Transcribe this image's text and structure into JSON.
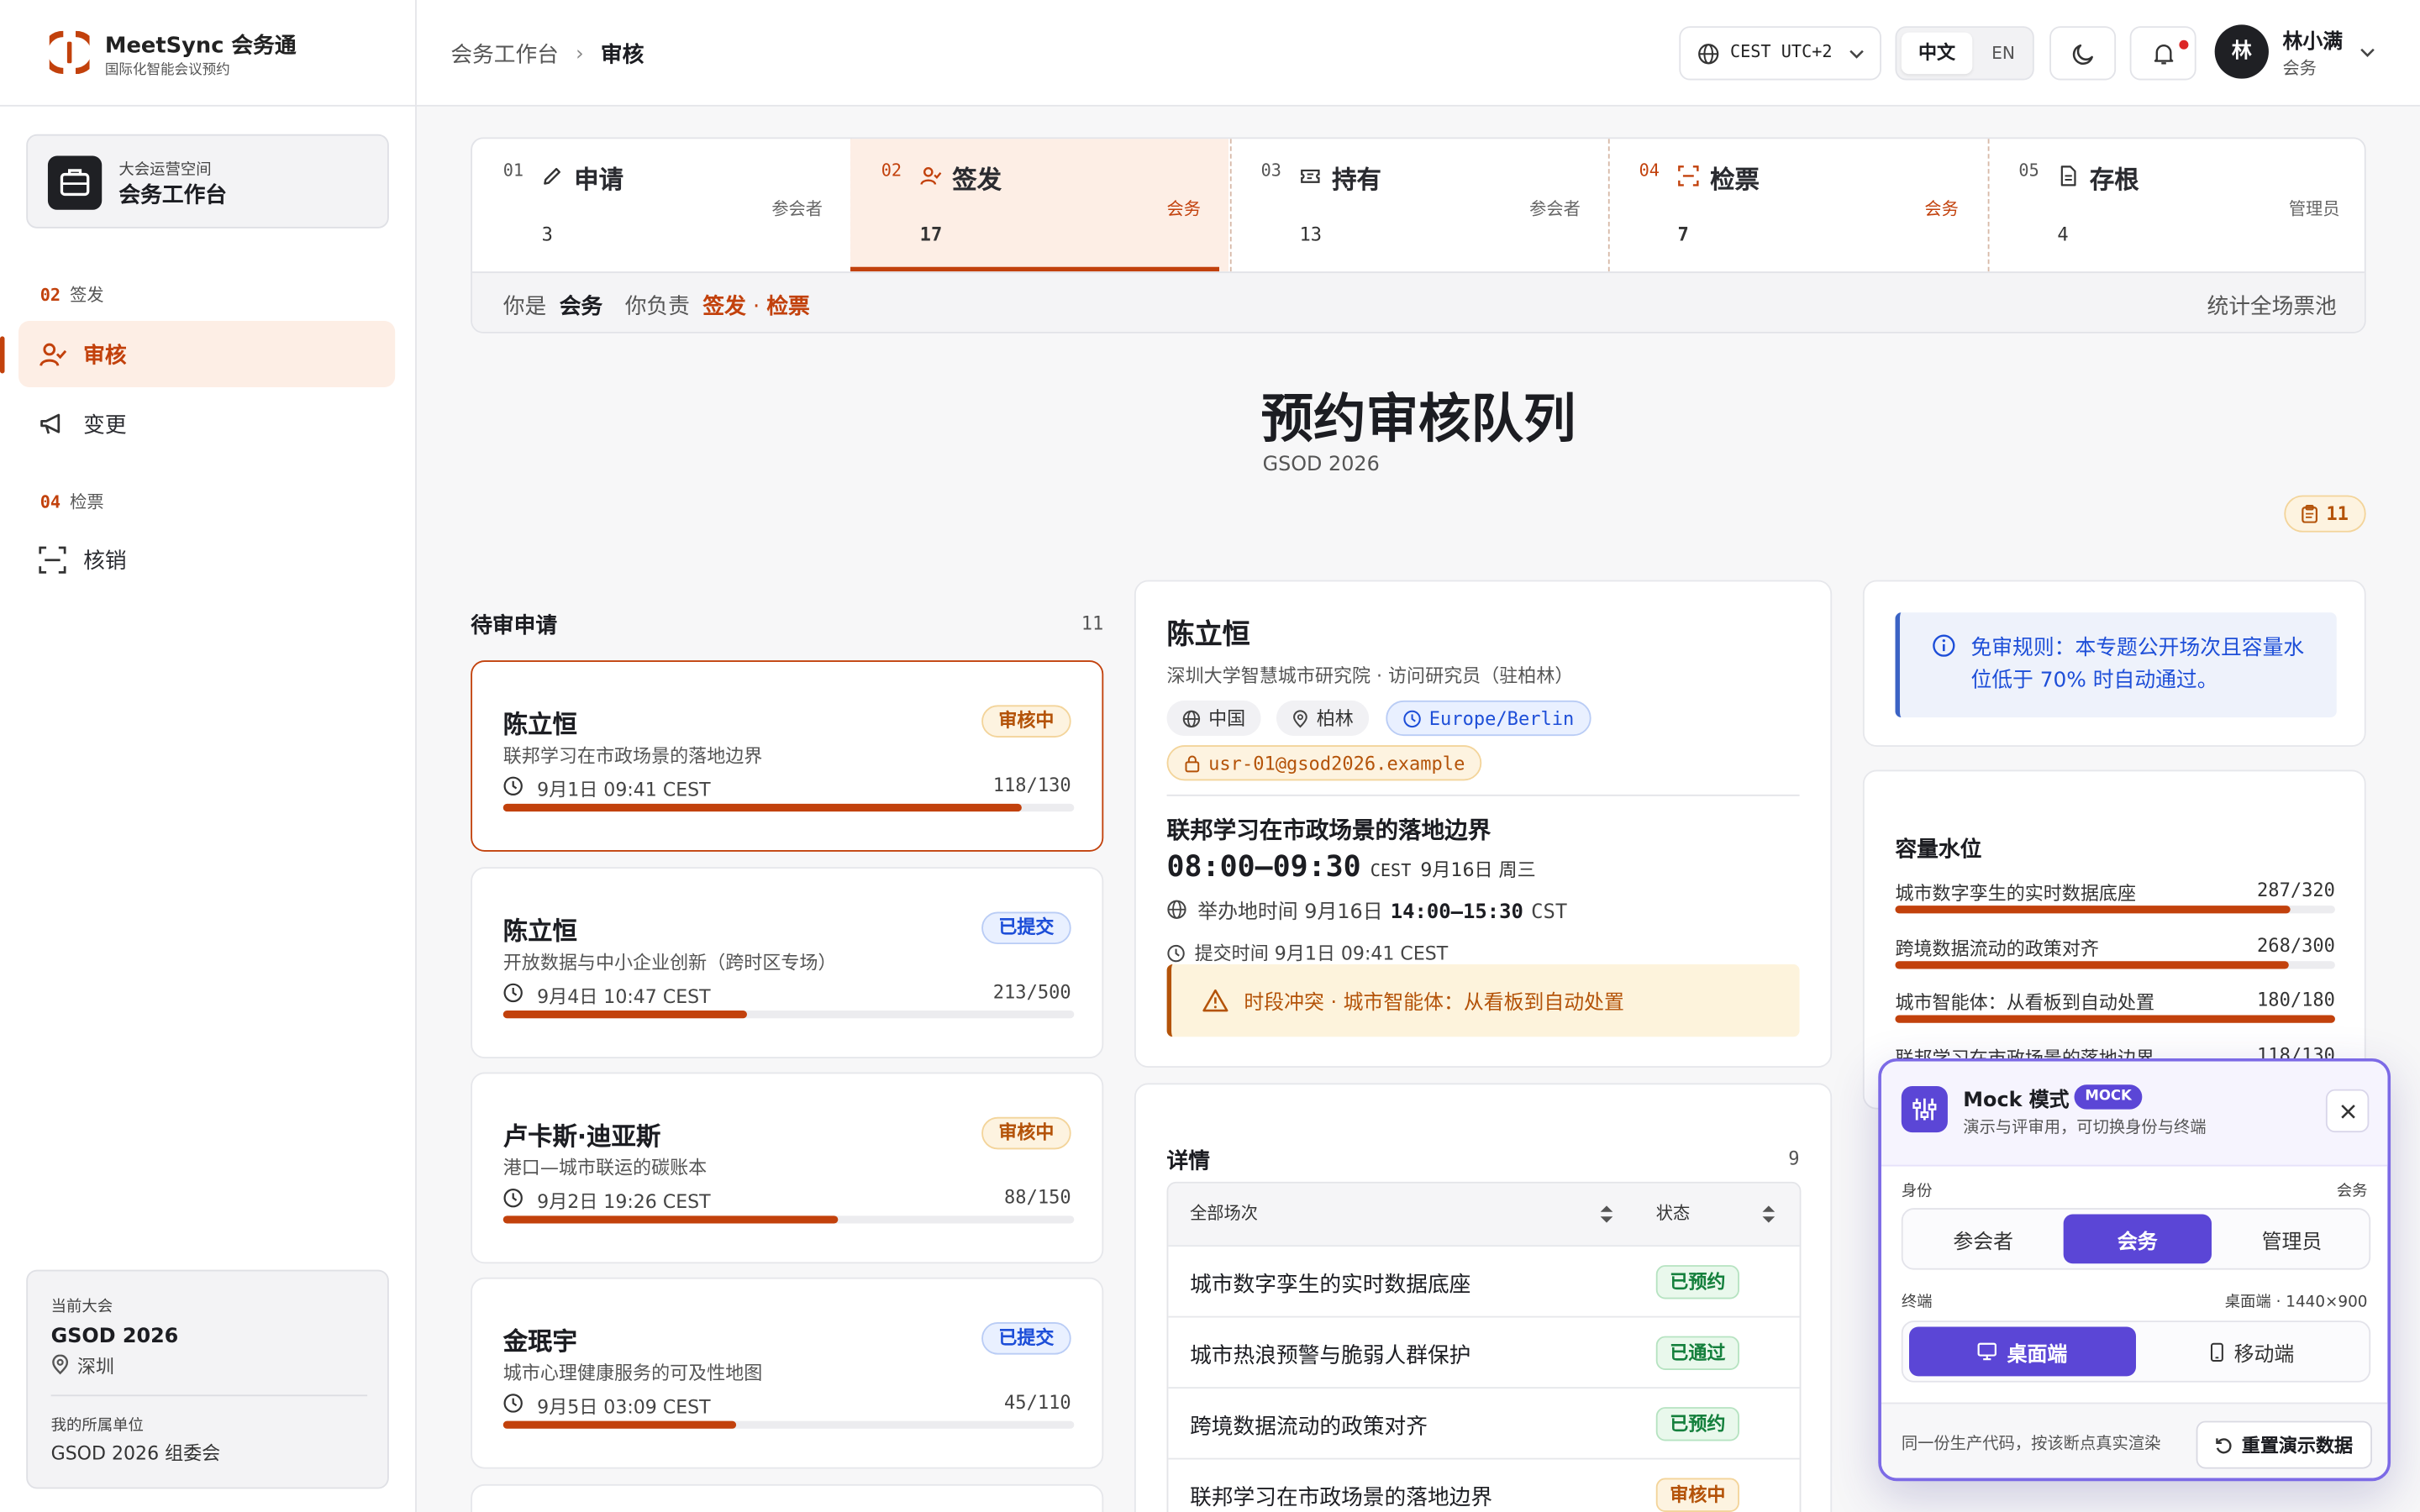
{
  "brand": {
    "name": "MeetSync 会务通",
    "tagline": "国际化智能会议预约"
  },
  "workspace": {
    "label": "大会运营空间",
    "name": "会务工作台"
  },
  "sidebar": {
    "sections": [
      {
        "num": "02",
        "label": "签发",
        "items": [
          {
            "label": "审核",
            "icon": "user-check-icon",
            "active": true
          },
          {
            "label": "变更",
            "icon": "megaphone-icon",
            "active": false
          }
        ]
      },
      {
        "num": "04",
        "label": "检票",
        "items": [
          {
            "label": "核销",
            "icon": "scan-icon",
            "active": false
          }
        ]
      }
    ],
    "conference": {
      "label": "当前大会",
      "name": "GSOD 2026",
      "city": "深圳",
      "unit_label": "我的所属单位",
      "unit": "GSOD 2026 组委会"
    }
  },
  "breadcrumb": {
    "parent": "会务工作台",
    "current": "审核"
  },
  "header": {
    "timezone": "CEST UTC+2",
    "lang_zh": "中文",
    "lang_en": "EN",
    "user_name": "林小满",
    "user_role": "会务",
    "avatar": "林"
  },
  "stepper": {
    "steps": [
      {
        "num": "01",
        "name": "申请",
        "role": "参会者",
        "count": "3",
        "icon": "pen-icon"
      },
      {
        "num": "02",
        "name": "签发",
        "role": "会务",
        "count": "17",
        "icon": "user-check-icon"
      },
      {
        "num": "03",
        "name": "持有",
        "role": "参会者",
        "count": "13",
        "icon": "ticket-icon"
      },
      {
        "num": "04",
        "name": "检票",
        "role": "会务",
        "count": "7",
        "icon": "scan-icon"
      },
      {
        "num": "05",
        "name": "存根",
        "role": "管理员",
        "count": "4",
        "icon": "file-icon"
      }
    ],
    "footer": {
      "you_are": "你是",
      "role": "会务",
      "responsible": "你负责",
      "duty1": "签发",
      "sep": "·",
      "duty2": "检票",
      "stats_link": "统计全场票池"
    }
  },
  "page": {
    "title": "预约审核队列",
    "subtitle": "GSOD 2026",
    "pending_count": "11"
  },
  "queue": {
    "title": "待审申请",
    "count": "11",
    "items": [
      {
        "name": "陈立恒",
        "session": "联邦学习在市政场景的落地边界",
        "time": "9月1日 09:41 CEST",
        "capacity": "118/130",
        "fill": 0.908,
        "status": "审核中",
        "kind": "rev"
      },
      {
        "name": "陈立恒",
        "session": "开放数据与中小企业创新（跨时区专场）",
        "time": "9月4日 10:47 CEST",
        "capacity": "213/500",
        "fill": 0.426,
        "status": "已提交",
        "kind": "sub"
      },
      {
        "name": "卢卡斯·迪亚斯",
        "session": "港口—城市联运的碳账本",
        "time": "9月2日 19:26 CEST",
        "capacity": "88/150",
        "fill": 0.587,
        "status": "审核中",
        "kind": "rev"
      },
      {
        "name": "金珉宇",
        "session": "城市心理健康服务的可及性地图",
        "time": "9月5日 03:09 CEST",
        "capacity": "45/110",
        "fill": 0.409,
        "status": "已提交",
        "kind": "sub"
      }
    ]
  },
  "detail": {
    "name": "陈立恒",
    "affiliation": "深圳大学智慧城市研究院 · 访问研究员（驻柏林）",
    "country": "中国",
    "city": "柏林",
    "tz": "Europe/Berlin",
    "email": "usr-01@gsod2026.example",
    "session": "联邦学习在市政场景的落地边界",
    "time_range": "08:00–09:30",
    "time_tz": "CEST",
    "date": "9月16日 周三",
    "host_label": "举办地时间 9月16日",
    "host_range": "14:00–15:30",
    "host_tz": "CST",
    "submitted": "提交时间 9月1日 09:41 CEST",
    "conflict": "时段冲突 · 城市智能体：从看板到自动处置"
  },
  "sessions": {
    "title": "详情",
    "count": "9",
    "col_session": "全部场次",
    "col_status": "状态",
    "rows": [
      {
        "name": "城市数字孪生的实时数据底座",
        "status": "已预约",
        "kind": "g"
      },
      {
        "name": "城市热浪预警与脆弱人群保护",
        "status": "已通过",
        "kind": "g"
      },
      {
        "name": "跨境数据流动的政策对齐",
        "status": "已预约",
        "kind": "g"
      },
      {
        "name": "联邦学习在市政场景的落地边界",
        "status": "审核中",
        "kind": "o"
      }
    ]
  },
  "rule": {
    "text": "免审规则：本专题公开场次且容量水位低于 70% 时自动通过。"
  },
  "capacity": {
    "title": "容量水位",
    "rows": [
      {
        "name": "城市数字孪生的实时数据底座",
        "value": "287/320",
        "fill": 0.897
      },
      {
        "name": "跨境数据流动的政策对齐",
        "value": "268/300",
        "fill": 0.893
      },
      {
        "name": "城市智能体：从看板到自动处置",
        "value": "180/180",
        "fill": 1.0
      },
      {
        "name": "联邦学习在市政场景的落地边界",
        "value": "118/130",
        "fill": 0.908
      }
    ]
  },
  "mock": {
    "title": "Mock 模式",
    "badge": "MOCK",
    "subtitle": "演示与评审用，可切换身份与终端",
    "identity_label": "身份",
    "identity_value": "会务",
    "identities": [
      "参会者",
      "会务",
      "管理员"
    ],
    "terminal_label": "终端",
    "terminal_value": "桌面端 · 1440×900",
    "terminals": [
      "桌面端",
      "移动端"
    ],
    "footer_note": "同一份生产代码，按该断点真实渲染",
    "reset": "重置演示数据"
  },
  "colors": {
    "accent": "#c2410c",
    "violet": "#5b46d6"
  }
}
